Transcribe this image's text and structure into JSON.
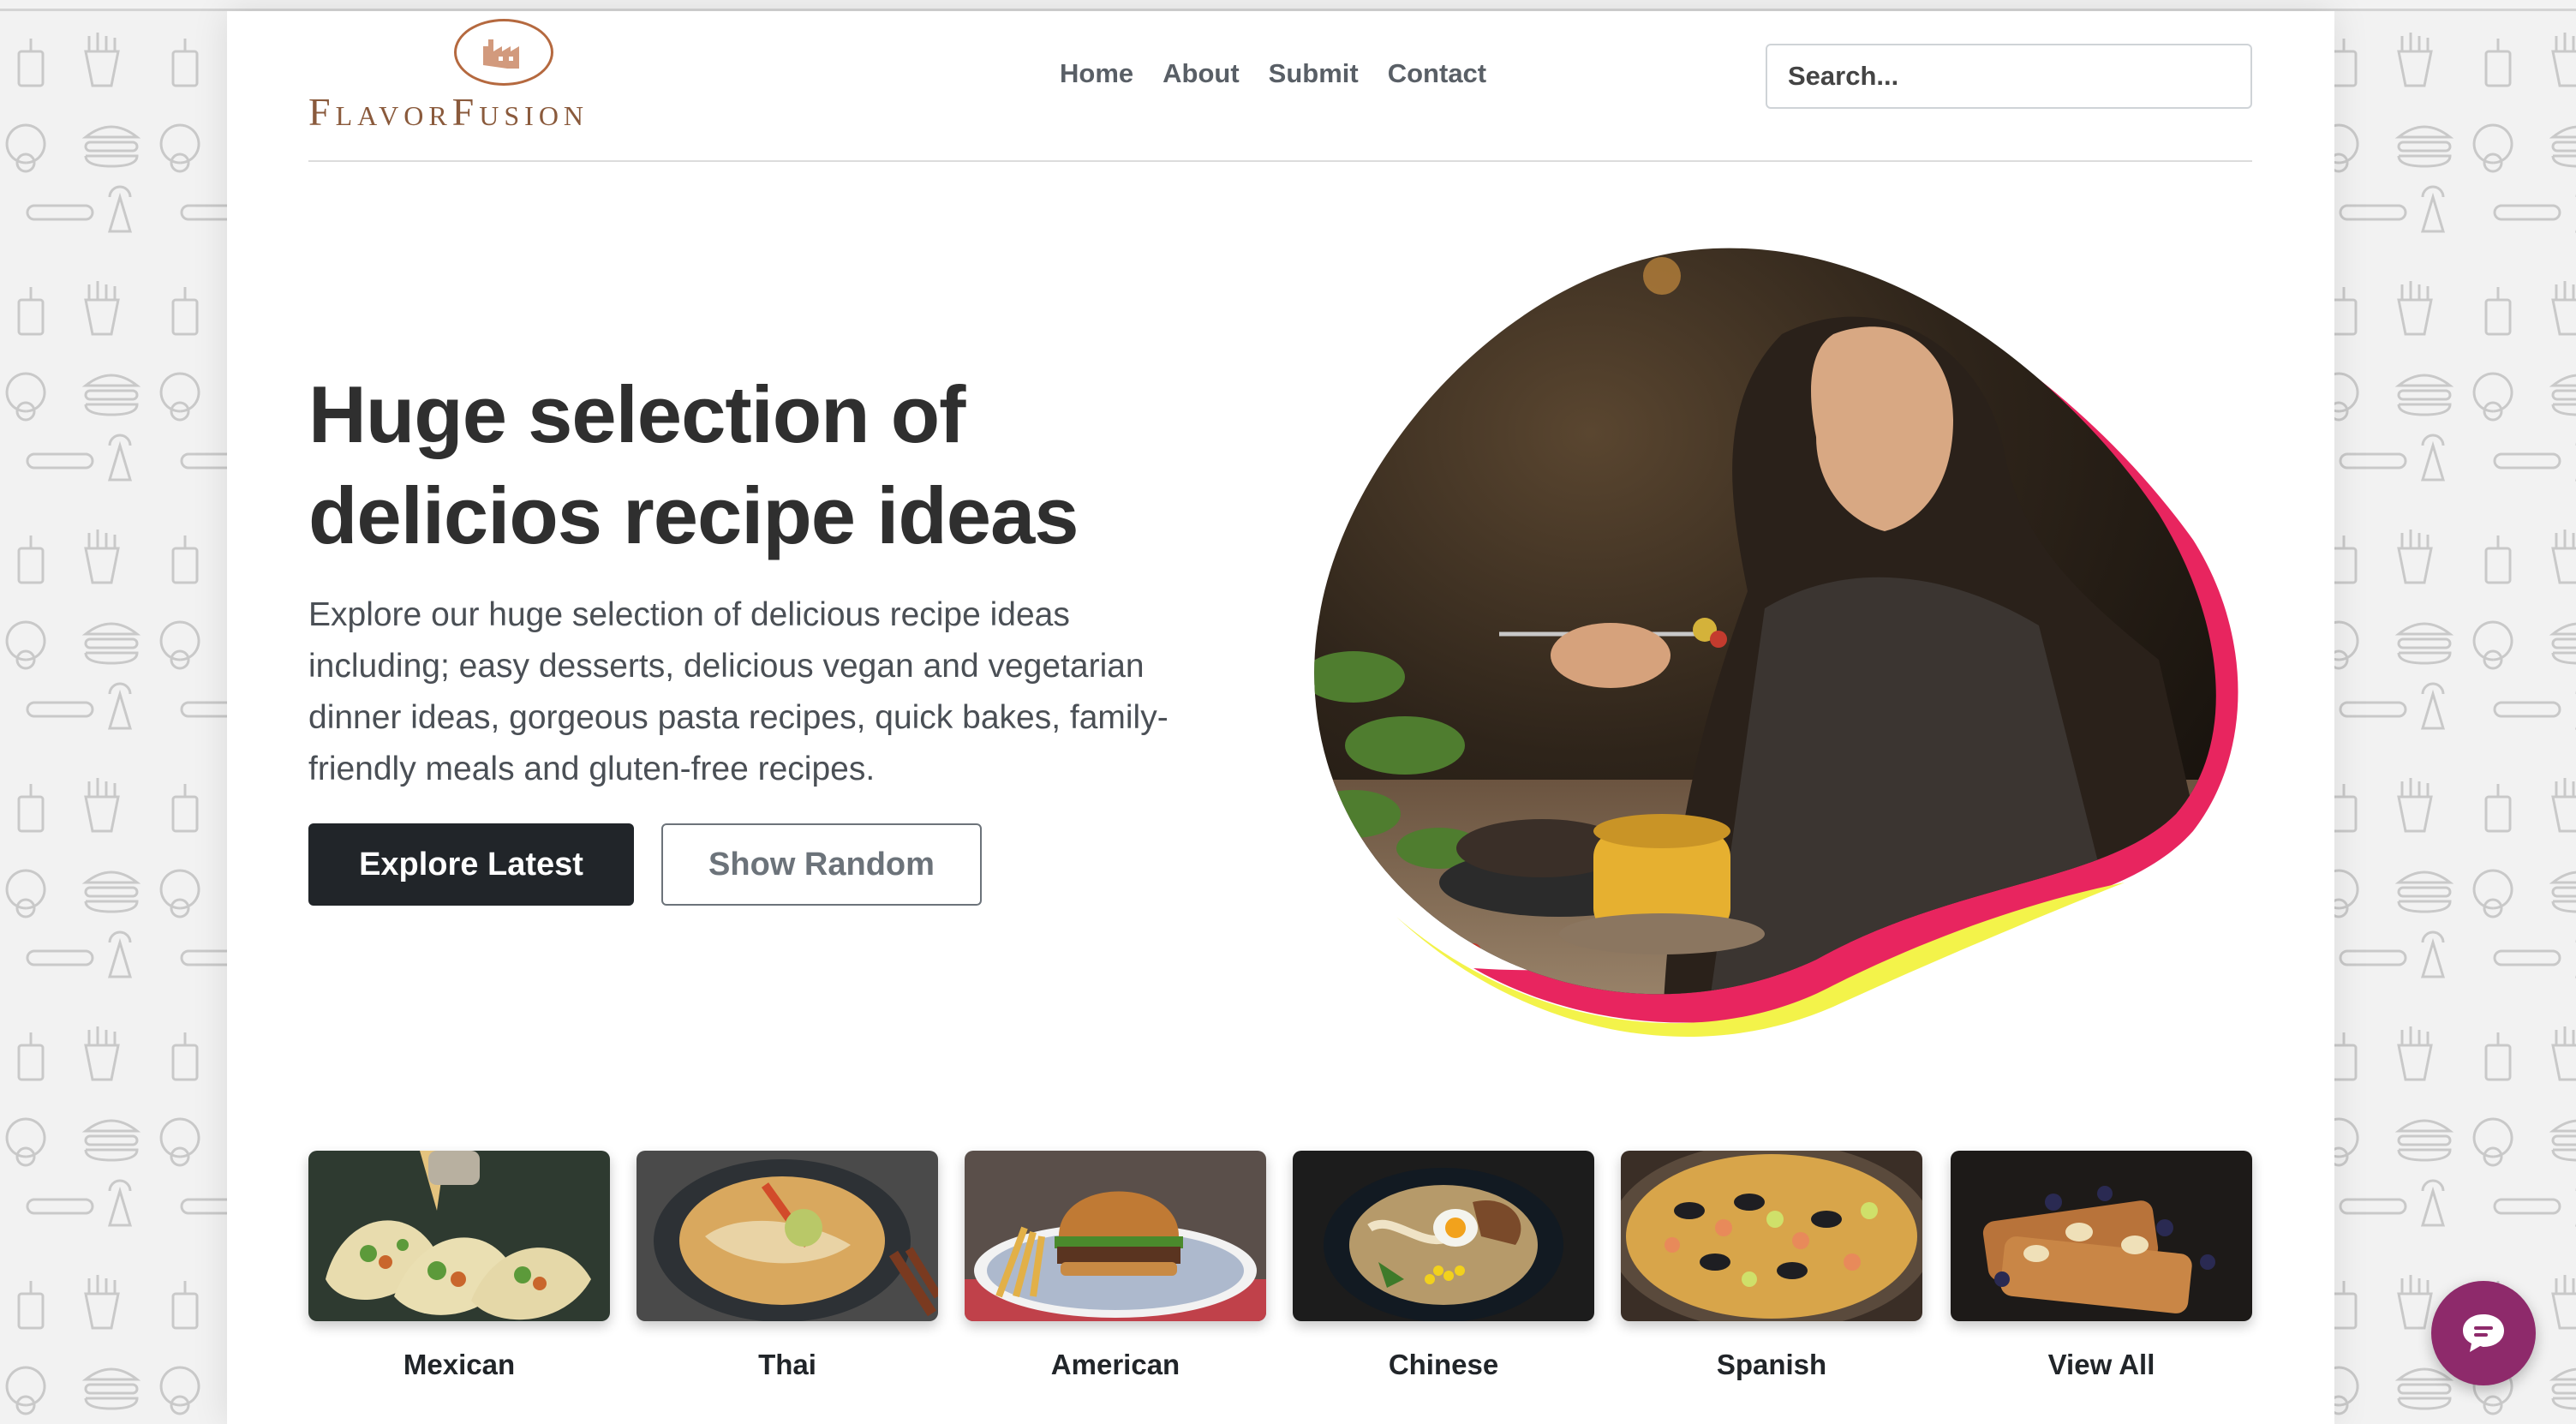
{
  "brand": {
    "name": "FlavorFusion",
    "logo_icon": "factory-icon",
    "color": "#8a5a3c"
  },
  "nav": {
    "items": [
      "Home",
      "About",
      "Submit",
      "Contact"
    ]
  },
  "search": {
    "placeholder": "Search..."
  },
  "hero": {
    "title": "Huge selection of delicios recipe ideas",
    "text": "Explore our huge selection of delicious recipe ideas including; easy desserts, delicious vegan and vegetarian dinner ideas, gorgeous pasta recipes, quick bakes, family-friendly meals and gluten-free recipes.",
    "primary_button": "Explore Latest",
    "secondary_button": "Show Random",
    "accent_colors": [
      "#e8255f",
      "#f3f34a"
    ]
  },
  "categories": [
    {
      "label": "Mexican",
      "image": "tacos"
    },
    {
      "label": "Thai",
      "image": "noodle-soup"
    },
    {
      "label": "American",
      "image": "burger-and-fries"
    },
    {
      "label": "Chinese",
      "image": "ramen-bowl"
    },
    {
      "label": "Spanish",
      "image": "paella"
    },
    {
      "label": "View All",
      "image": "french-toast"
    }
  ],
  "chat": {
    "icon": "chat-bubble-icon",
    "color": "#8e2a6b"
  }
}
